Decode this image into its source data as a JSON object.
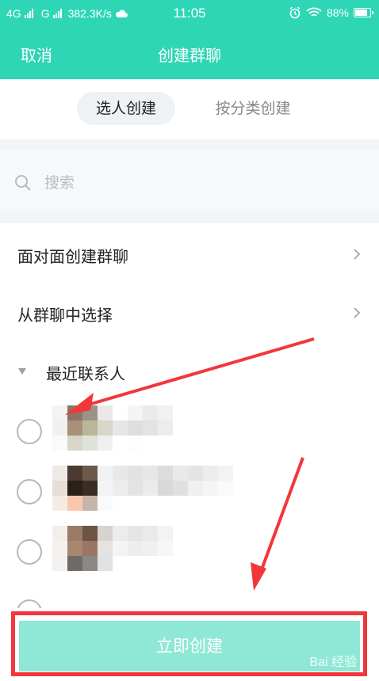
{
  "status_bar": {
    "network1": "4G",
    "network2": "G",
    "speed": "382.3K/s",
    "time": "11:05",
    "battery": "88%",
    "battery_level": 0.88
  },
  "header": {
    "cancel_label": "取消",
    "title": "创建群聊"
  },
  "tabs": [
    {
      "label": "选人创建",
      "active": true
    },
    {
      "label": "按分类创建",
      "active": false
    }
  ],
  "search": {
    "placeholder": "搜索"
  },
  "menu": [
    {
      "label": "面对面创建群聊"
    },
    {
      "label": "从群聊中选择"
    }
  ],
  "recent": {
    "label": "最近联系人"
  },
  "create_button": {
    "label": "立即创建"
  },
  "watermark": "Bai 经验",
  "colors": {
    "accent": "#2fd6b6",
    "button_disabled": "#8fe8d6",
    "highlight": "#f2373b"
  }
}
